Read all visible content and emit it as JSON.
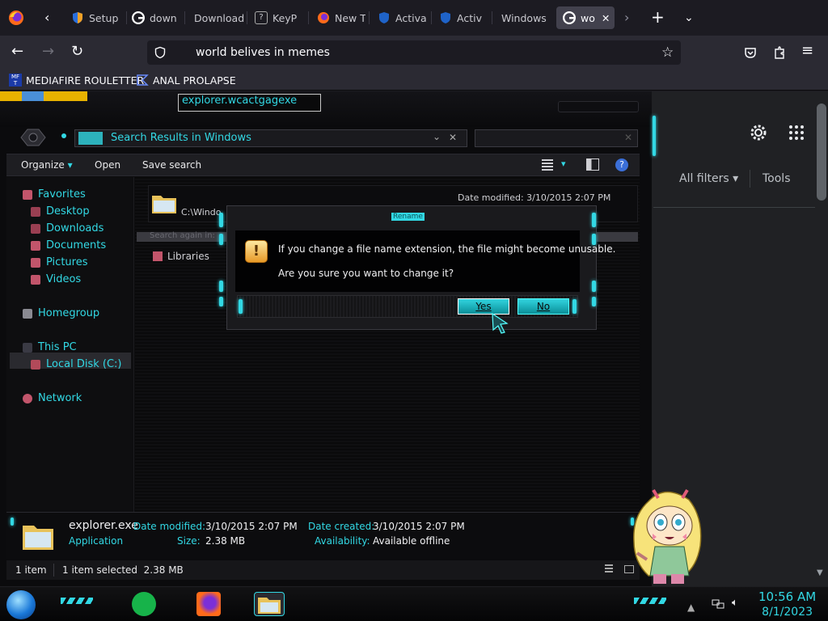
{
  "browser": {
    "tabs": [
      {
        "label": "Setup",
        "favicon": "shield-icon"
      },
      {
        "label": "down",
        "favicon": "google-icon"
      },
      {
        "label": "Download",
        "favicon": "none"
      },
      {
        "label": "KeyP",
        "favicon": "question-icon"
      },
      {
        "label": "New T",
        "favicon": "firefox-icon"
      },
      {
        "label": "Activa",
        "favicon": "shield-icon"
      },
      {
        "label": "Activ",
        "favicon": "shield-icon"
      },
      {
        "label": "Windows",
        "favicon": "none"
      },
      {
        "label": "wo",
        "favicon": "google-icon"
      }
    ],
    "url": "world belives in memes",
    "bookmarks": [
      {
        "label": "MEDIAFIRE ROULETTER",
        "icon": "mediafire-icon"
      },
      {
        "label": "ANAL PROLAPSE",
        "icon": "folder-bookmark-icon"
      }
    ]
  },
  "google": {
    "all_filters": "All filters",
    "tools": "Tools"
  },
  "explorer": {
    "address": "Search Results in Windows",
    "commands": {
      "organize": "Organize",
      "open": "Open",
      "save_search": "Save search"
    },
    "nav": {
      "favorites": "Favorites",
      "desktop": "Desktop",
      "downloads": "Downloads",
      "documents": "Documents",
      "pictures": "Pictures",
      "videos": "Videos",
      "homegroup": "Homegroup",
      "this_pc": "This PC",
      "local_disk": "Local Disk (C:)",
      "network": "Network"
    },
    "file": {
      "rename_value": "explorer.wcactgagexe",
      "path": "C:\\Windo",
      "date_modified": "Date modified: 3/10/2015 2:07 PM",
      "search_again": "Search again in:",
      "libraries": "Libraries"
    },
    "details": {
      "name": "explorer.exe",
      "type": "Application",
      "date_modified_label": "Date modified:",
      "date_modified_value": "3/10/2015 2:07 PM",
      "size_label": "Size:",
      "size_value": "2.38 MB",
      "date_created_label": "Date created:",
      "date_created_value": "3/10/2015 2:07 PM",
      "availability_label": "Availability:",
      "availability_value": "Available offline"
    },
    "status": {
      "items": "1 item",
      "selected": "1 item selected  2.38 MB"
    }
  },
  "dialog": {
    "title": "Rename",
    "line1": "If you change a file name extension, the file might become unusable.",
    "line2": "Are you sure you want to change it?",
    "yes": "Yes",
    "no": "No"
  },
  "taskbar": {
    "time": "10:56 AM",
    "date": "8/1/2023"
  },
  "colors": {
    "accent": "#32d8e4",
    "background": "#0b0b0d"
  }
}
